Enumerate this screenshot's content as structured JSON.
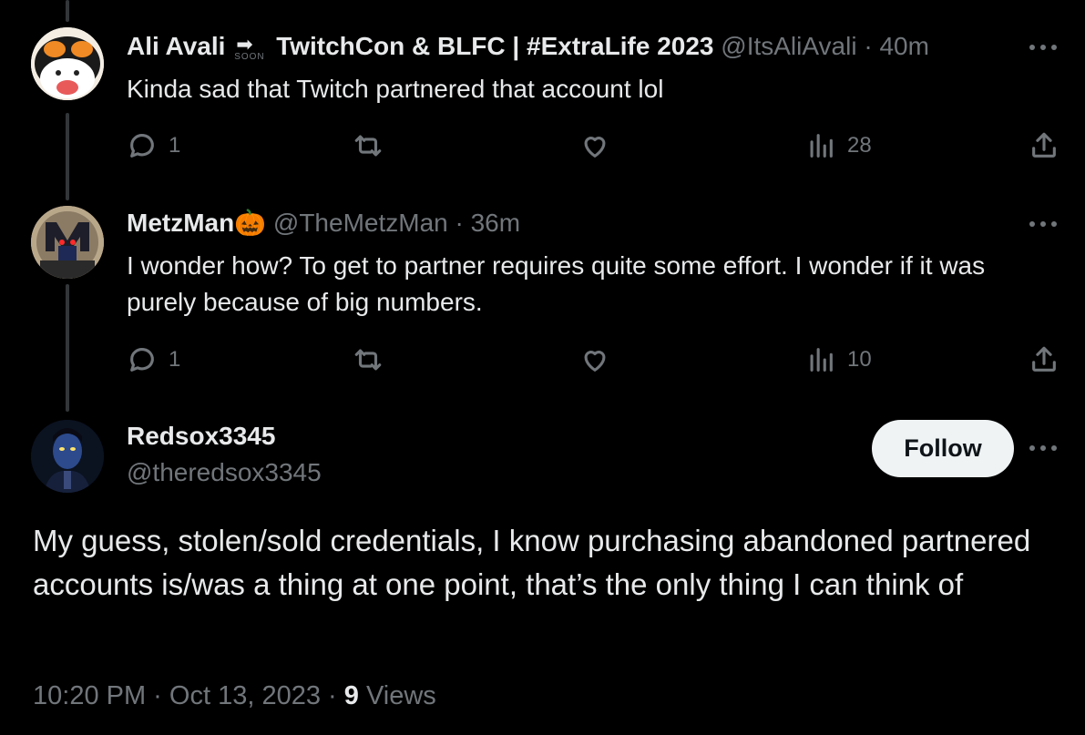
{
  "tweets": [
    {
      "display_name_part1": "Ali Avali",
      "badge_label": "SOON",
      "display_name_part2": "TwitchCon & BLFC | #ExtraLife 2023",
      "handle": "@ItsAliAvali",
      "separator": "·",
      "time": "40m",
      "text": "Kinda sad that Twitch partnered that account lol",
      "replies": "1",
      "views": "28"
    },
    {
      "display_name": "MetzMan",
      "emoji": "🎃",
      "handle": "@TheMetzMan",
      "separator": "·",
      "time": "36m",
      "text": "I wonder how? To get to partner requires quite some effort. I wonder if it was purely because of big numbers.",
      "replies": "1",
      "views": "10"
    }
  ],
  "main_tweet": {
    "display_name": "Redsox3345",
    "handle": "@theredsox3345",
    "follow_label": "Follow",
    "text": "My guess, stolen/sold credentials, I know purchasing abandoned partnered accounts is/was a thing at one point, that’s the only thing I can think of",
    "timestamp": "10:20 PM · Oct 13, 2023 · ",
    "views_count": "9",
    "views_label": "Views"
  },
  "icons": {
    "reply": "reply-bubble-icon",
    "retweet": "retweet-icon",
    "like": "heart-icon",
    "views": "analytics-bars-icon",
    "share": "share-upload-icon",
    "more": "more-dots-icon"
  },
  "colors": {
    "background": "#000000",
    "primary_text": "#e7e9ea",
    "secondary_text": "#71767b",
    "thread_line": "#333639",
    "follow_button_bg": "#eff3f4"
  }
}
